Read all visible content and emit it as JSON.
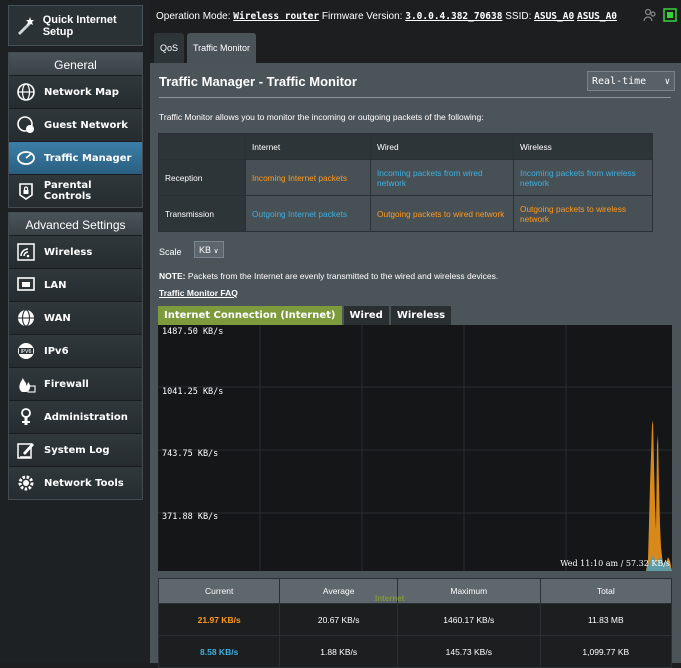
{
  "sidebar": {
    "quick_setup": "Quick Internet Setup",
    "general_title": "General",
    "general_items": [
      {
        "label": "Network Map"
      },
      {
        "label": "Guest Network"
      },
      {
        "label": "Traffic Manager"
      },
      {
        "label": "Parental Controls"
      }
    ],
    "advanced_title": "Advanced Settings",
    "advanced_items": [
      {
        "label": "Wireless"
      },
      {
        "label": "LAN"
      },
      {
        "label": "WAN"
      },
      {
        "label": "IPv6"
      },
      {
        "label": "Firewall"
      },
      {
        "label": "Administration"
      },
      {
        "label": "System Log"
      },
      {
        "label": "Network Tools"
      }
    ]
  },
  "topbar": {
    "op_mode_label": "Operation Mode:",
    "op_mode": "Wireless router",
    "fw_label": "Firmware Version:",
    "fw": "3.0.0.4.382_70638",
    "ssid_label": "SSID:",
    "ssid1": "ASUS_A0",
    "ssid2": "ASUS_A0"
  },
  "tabs": [
    "QoS",
    "Traffic Monitor"
  ],
  "panel": {
    "title": "Traffic Manager - Traffic Monitor",
    "mode_select": "Real-time",
    "description": "Traffic Monitor allows you to monitor the incoming or outgoing packets of the following:",
    "table": {
      "headers": [
        "",
        "Internet",
        "Wired",
        "Wireless"
      ],
      "rows": [
        {
          "label": "Reception",
          "internet": "Incoming Internet packets",
          "wired": "Incoming packets from wired network",
          "wireless": "Incoming packets from wireless network"
        },
        {
          "label": "Transmission",
          "internet": "Outgoing Internet packets",
          "wired": "Outgoing packets to wired network",
          "wireless": "Outgoing packets to wireless network"
        }
      ]
    },
    "scale_label": "Scale",
    "scale_value": "KB",
    "note_bold": "NOTE:",
    "note_text": " Packets from the Internet are evenly transmitted to the wired and wireless devices.",
    "faq_link": "Traffic Monitor FAQ",
    "graph_tabs": [
      "Internet Connection (Internet)",
      "Wired",
      "Wireless"
    ],
    "y_labels": [
      "1487.50 KB/s",
      "1041.25 KB/s",
      "743.75 KB/s",
      "371.88 KB/s"
    ],
    "timestamp": "Wed 11:10 am / 57.32 KB/s",
    "overlay_label": "Internet",
    "stats": {
      "headers": [
        "Current",
        "Average",
        "Maximum",
        "Total"
      ],
      "rows": [
        {
          "current": "21.97 KB/s",
          "average": "20.67 KB/s",
          "maximum": "1460.17 KB/s",
          "total": "11.83 MB",
          "color": "#ff9a1e"
        },
        {
          "current": "8.58 KB/s",
          "average": "1.88 KB/s",
          "maximum": "145.73 KB/s",
          "total": "1,099.77 KB",
          "color": "#3fb0e0"
        }
      ]
    }
  },
  "colors": {
    "orange": "#ff9a1e",
    "blue": "#3fb0e0",
    "active_tab": "#7d9a3c",
    "active_nav": "#3c7fa8"
  }
}
